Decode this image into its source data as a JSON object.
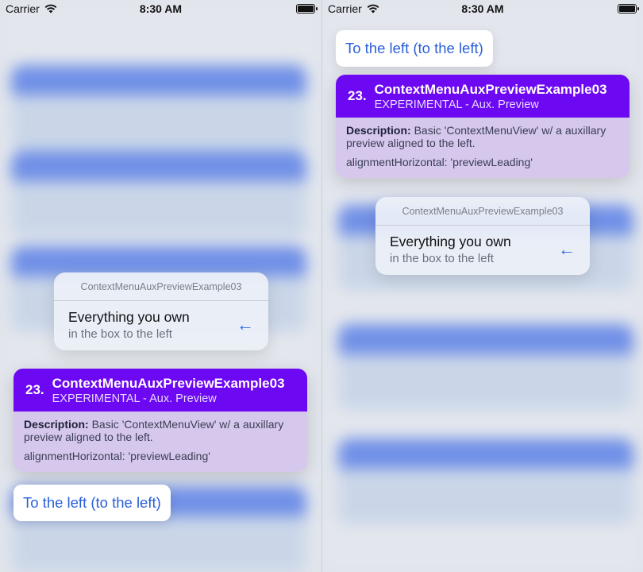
{
  "status_bar": {
    "carrier": "Carrier",
    "time": "8:30 AM",
    "wifi_icon": "wifi-icon",
    "battery_icon": "battery-icon"
  },
  "context_menu": {
    "title": "ContextMenuAuxPreviewExample03",
    "item": {
      "title": "Everything you own",
      "subtitle": "in the box to the left",
      "icon": "arrow-left-icon",
      "icon_glyph": "←"
    }
  },
  "preview_card": {
    "number": "23.",
    "title": "ContextMenuAuxPreviewExample03",
    "subtitle": "EXPERIMENTAL - Aux. Preview",
    "description_label": "Description:",
    "description_text": " Basic 'ContextMenuView' w/ a auxillary preview aligned to the left.",
    "alignment_text": "alignmentHorizontal: 'previewLeading'"
  },
  "aux_preview": {
    "label": "To the left (to the left)"
  },
  "colors": {
    "header_purple": "#6d08f3",
    "body_lavender": "#d6c8ec",
    "accent_blue": "#2a5fd9"
  }
}
